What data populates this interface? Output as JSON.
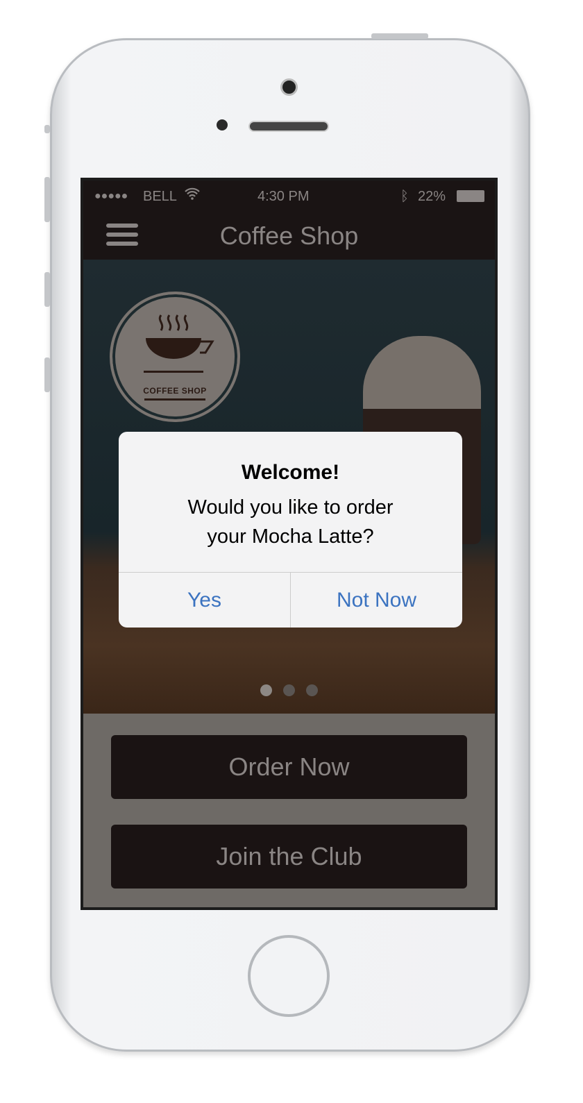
{
  "status_bar": {
    "signal": "●●●●●",
    "carrier": "BELL",
    "time": "4:30 PM",
    "battery": "22%",
    "battery_level": 0.22
  },
  "nav": {
    "title": "Coffee Shop"
  },
  "hero": {
    "logo_text": "COFFEE SHOP",
    "carousel_pages": 3,
    "active_page": 1
  },
  "alert": {
    "title": "Welcome!",
    "message": "Would you like to order your Mocha Latte?",
    "yes": "Yes",
    "no": "Not Now",
    "action_color": "#3b73c0"
  },
  "buttons": {
    "order": "Order Now",
    "club": "Join the Club"
  }
}
